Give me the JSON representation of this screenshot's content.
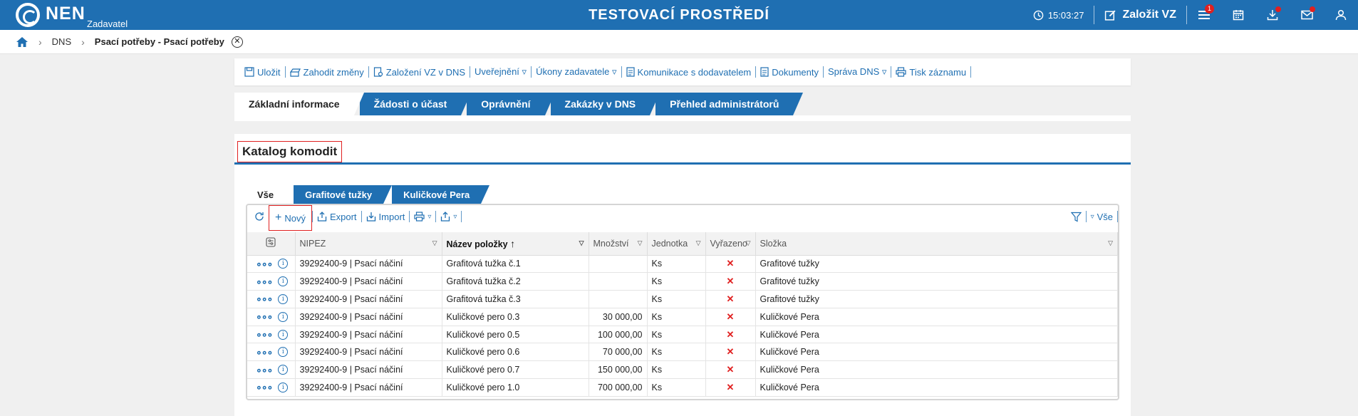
{
  "header": {
    "logo_text": "NEN",
    "logo_subtitle": "Zadavatel",
    "environment_title": "TESTOVACÍ PROSTŘEDÍ",
    "clock": "15:03:27",
    "create_vz_label": "Založit VZ",
    "menu_badge": "1",
    "icons": [
      "clock-icon",
      "edit-icon",
      "menu-icon",
      "calendar-icon",
      "download-icon",
      "mail-icon",
      "user-icon"
    ]
  },
  "breadcrumb": {
    "items": [
      "DNS"
    ],
    "current": "Psací potřeby - Psací potřeby"
  },
  "toolbar": {
    "items": [
      "Uložit",
      "Zahodit změny",
      "Založení VZ v DNS",
      "Uveřejnění ▿",
      "Úkony zadavatele ▿",
      "Komunikace s dodavatelem",
      "Dokumenty",
      "Správa DNS ▿",
      "Tisk záznamu"
    ]
  },
  "main_tabs": [
    "Základní informace",
    "Žádosti o účast",
    "Oprávnění",
    "Zakázky v DNS",
    "Přehled administrátorů"
  ],
  "section": {
    "title": "Katalog komodit"
  },
  "sub_tabs": [
    "Vše",
    "Grafitové tužky",
    "Kuličkové Pera"
  ],
  "grid_toolbar": {
    "new_label": "Nový",
    "export_label": "Export",
    "import_label": "Import",
    "filter_label": "Vše"
  },
  "table": {
    "columns": [
      "NIPEZ",
      "Název položky",
      "Množství",
      "Jednotka",
      "Vyřazeno",
      "Složka"
    ],
    "rows": [
      [
        "39292400-9 | Psací náčiní",
        "Grafitová tužka č.1",
        "",
        "Ks",
        "✕",
        "Grafitové tužky"
      ],
      [
        "39292400-9 | Psací náčiní",
        "Grafitová tužka č.2",
        "",
        "Ks",
        "✕",
        "Grafitové tužky"
      ],
      [
        "39292400-9 | Psací náčiní",
        "Grafitová tužka č.3",
        "",
        "Ks",
        "✕",
        "Grafitové tužky"
      ],
      [
        "39292400-9 | Psací náčiní",
        "Kuličkové pero 0.3",
        "30 000,00",
        "Ks",
        "✕",
        "Kuličkové Pera"
      ],
      [
        "39292400-9 | Psací náčiní",
        "Kuličkové pero 0.5",
        "100 000,00",
        "Ks",
        "✕",
        "Kuličkové Pera"
      ],
      [
        "39292400-9 | Psací náčiní",
        "Kuličkové pero 0.6",
        "70 000,00",
        "Ks",
        "✕",
        "Kuličkové Pera"
      ],
      [
        "39292400-9 | Psací náčiní",
        "Kuličkové pero 0.7",
        "150 000,00",
        "Ks",
        "✕",
        "Kuličkové Pera"
      ],
      [
        "39292400-9 | Psací náčiní",
        "Kuličkové pero 1.0",
        "700 000,00",
        "Ks",
        "✕",
        "Kuličkové Pera"
      ]
    ]
  },
  "colors": {
    "brand": "#1f6fb2",
    "alert": "#e02020"
  }
}
